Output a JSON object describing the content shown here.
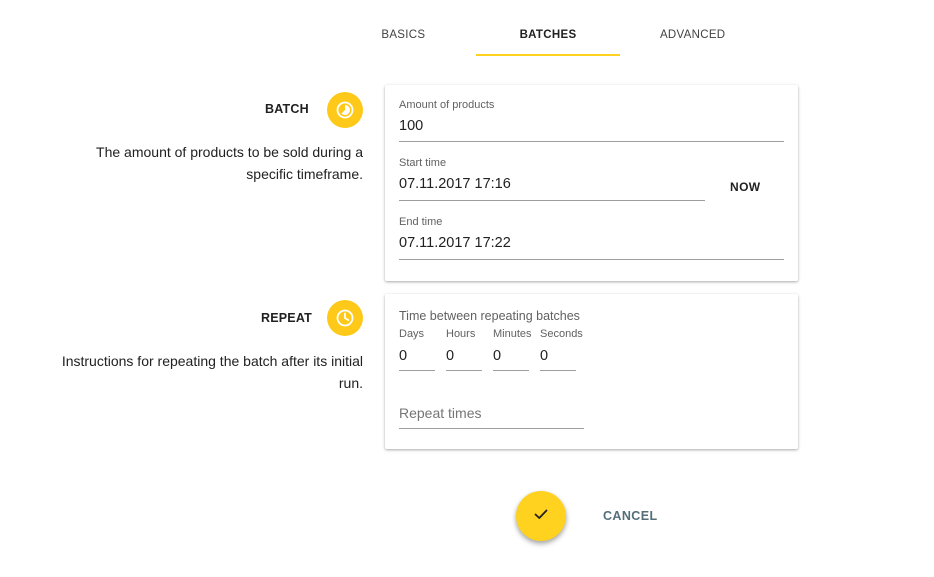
{
  "tabs": [
    {
      "label": "BASICS",
      "active": false
    },
    {
      "label": "BATCHES",
      "active": true
    },
    {
      "label": "ADVANCED",
      "active": false
    }
  ],
  "batch": {
    "title": "BATCH",
    "icon": "timelapse-icon",
    "description_line1": "The amount of products to be sold during a",
    "description_line2": "specific timeframe.",
    "amount_label": "Amount of products",
    "amount_value": "100",
    "start_label": "Start time",
    "start_value": "07.11.2017 17:16",
    "now_label": "NOW",
    "end_label": "End time",
    "end_value": "07.11.2017 17:22"
  },
  "repeat": {
    "title": "REPEAT",
    "icon": "clock-icon",
    "description_line1": "Instructions for repeating the batch after its initial",
    "description_line2": "run.",
    "interval_label": "Time between repeating batches",
    "units": [
      {
        "label": "Days",
        "value": "0"
      },
      {
        "label": "Hours",
        "value": "0"
      },
      {
        "label": "Minutes",
        "value": "0"
      },
      {
        "label": "Seconds",
        "value": "0"
      }
    ],
    "repeat_times_placeholder": "Repeat times"
  },
  "actions": {
    "confirm_icon": "check-icon",
    "cancel_label": "CANCEL"
  },
  "colors": {
    "accent": "#ffd21f",
    "icon_bg": "#ffc919",
    "cancel_text": "#546e7a"
  }
}
